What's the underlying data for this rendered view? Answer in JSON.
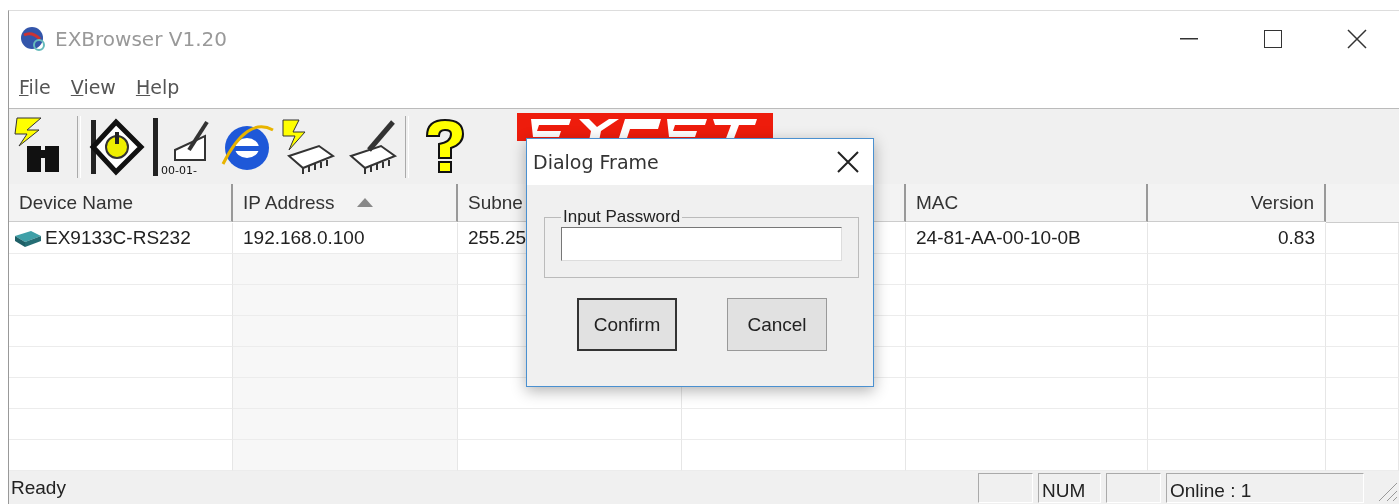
{
  "window": {
    "title": "EXBrowser V1.20"
  },
  "menu": [
    {
      "label": "File"
    },
    {
      "label": "View"
    },
    {
      "label": "Help"
    }
  ],
  "toolbar": {
    "icon_caption": "00-01-"
  },
  "table": {
    "columns": [
      {
        "label": "Device Name",
        "sorted": false
      },
      {
        "label": "IP Address",
        "sorted": true
      },
      {
        "label": "Subne"
      },
      {},
      {
        "label": "MAC",
        "sorted": false
      },
      {
        "label": "Version",
        "sorted": false
      }
    ],
    "rows": [
      {
        "cells": [
          "EX9133C-RS232",
          "192.168.0.100",
          "255.25",
          null,
          "24-81-AA-00-10-0B",
          "0.83"
        ]
      }
    ]
  },
  "dialog": {
    "title": "Dialog Frame",
    "group_label": "Input Password",
    "buttons": [
      {
        "label": "Confirm",
        "default": true
      },
      {
        "label": "Cancel",
        "default": false
      }
    ]
  },
  "status_bar": {
    "text": "Ready",
    "num": "NUM",
    "online": "Online : 1"
  }
}
